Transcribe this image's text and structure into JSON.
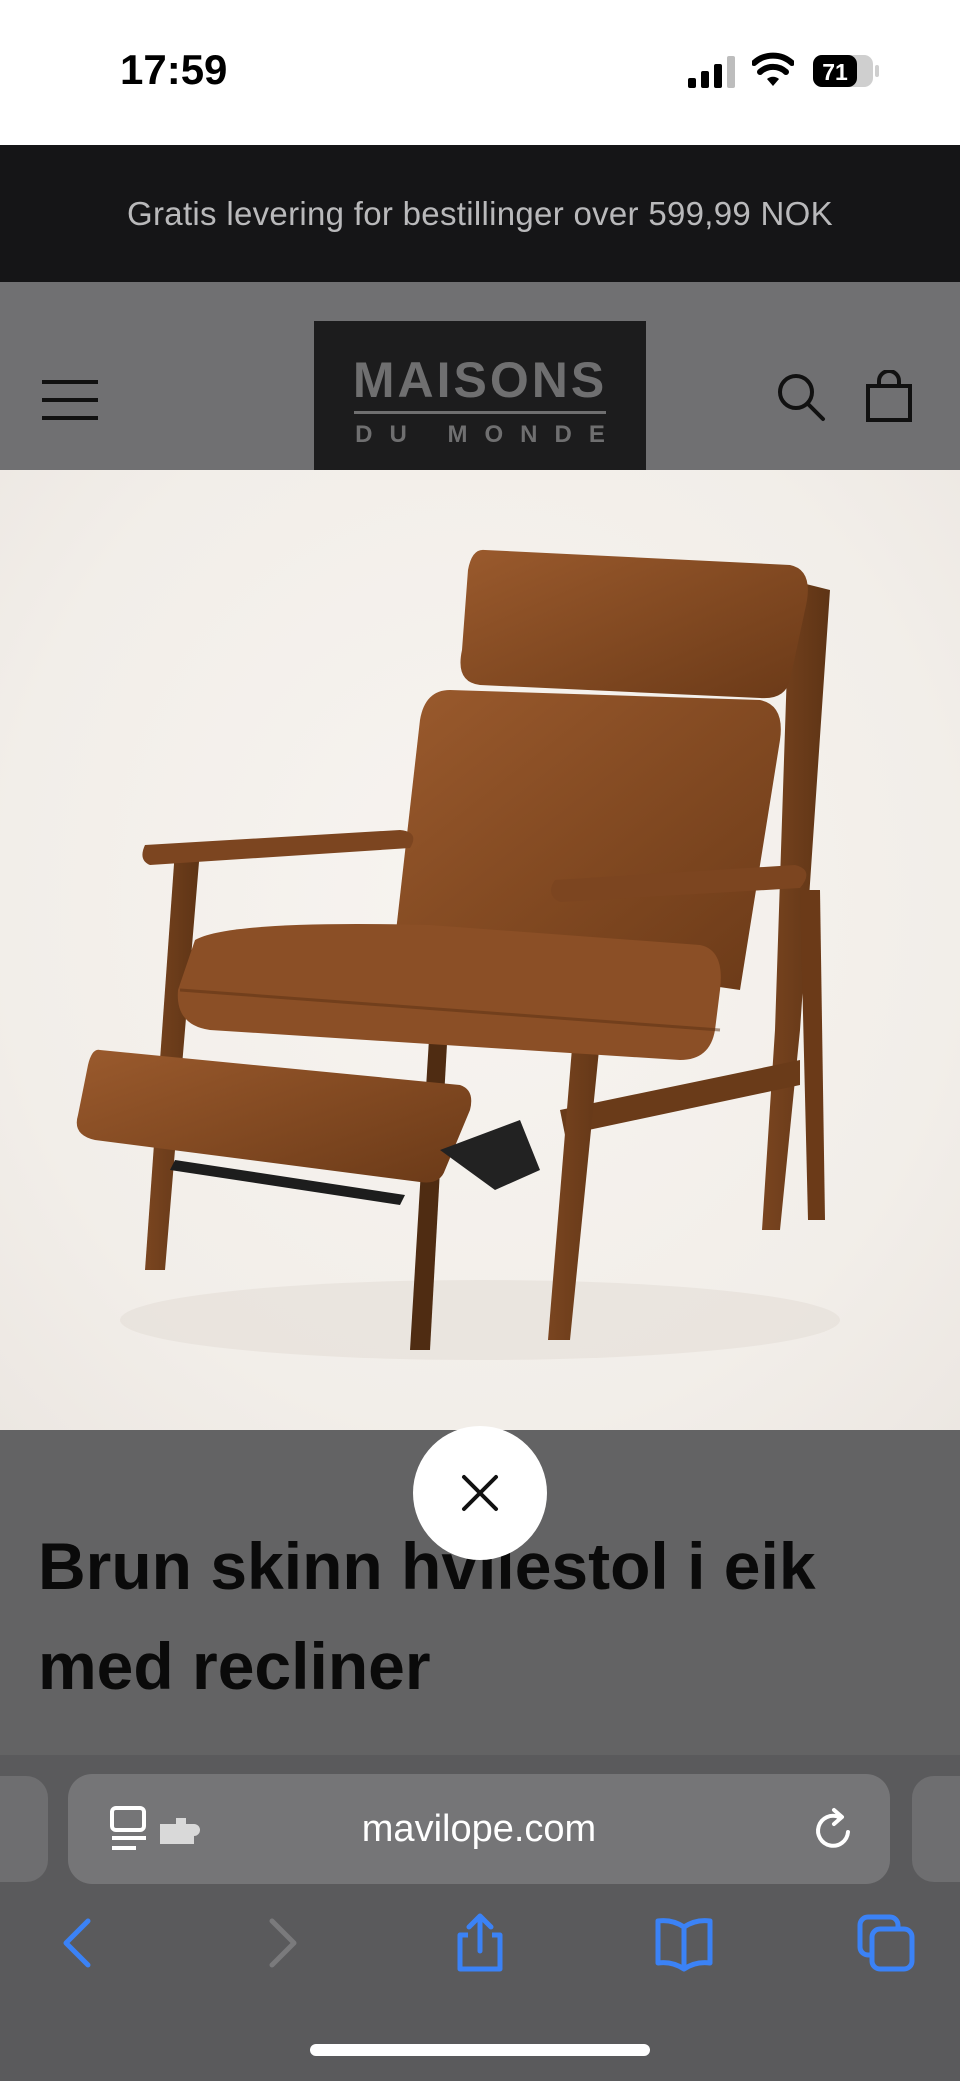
{
  "status_bar": {
    "time": "17:59",
    "battery": "71"
  },
  "promo": {
    "text": "Gratis levering for bestillinger over 599,99 NOK"
  },
  "header": {
    "logo_main": "MAISONS",
    "logo_sub": "DU MONDE"
  },
  "product": {
    "title": "Brun skinn hvilestol i eik med recliner"
  },
  "browser": {
    "url": "mavilope.com"
  },
  "colors": {
    "accent": "#3b82f6",
    "overlay": "#5d5d5f",
    "banner": "#151517"
  }
}
